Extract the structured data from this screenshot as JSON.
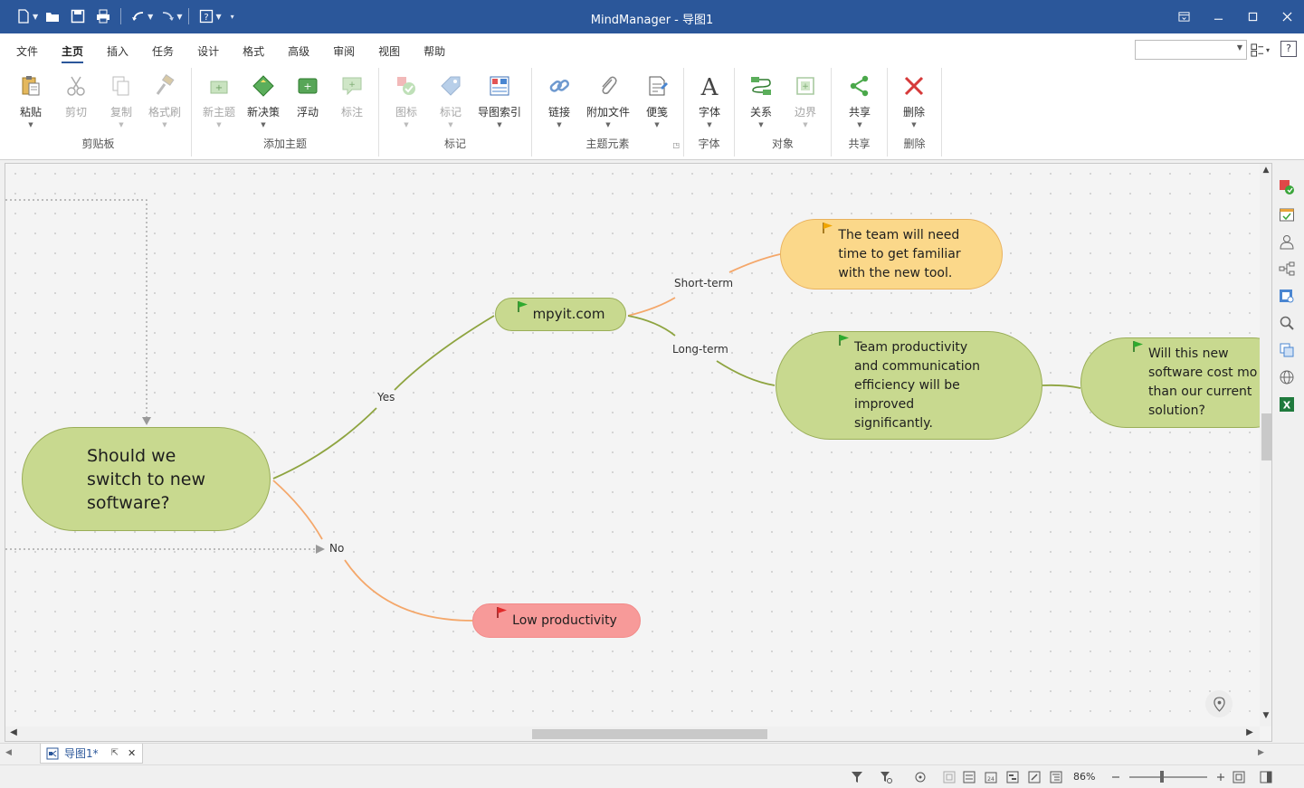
{
  "app": {
    "title": "MindManager - 导图1"
  },
  "quick_access": {
    "icons": [
      "new-icon",
      "open-icon",
      "save-icon",
      "print-icon",
      "undo-icon",
      "redo-icon",
      "help-icon",
      "customize-icon"
    ]
  },
  "menu": {
    "tabs": [
      {
        "label": "文件"
      },
      {
        "label": "主页"
      },
      {
        "label": "插入"
      },
      {
        "label": "任务"
      },
      {
        "label": "设计"
      },
      {
        "label": "格式"
      },
      {
        "label": "高级"
      },
      {
        "label": "审阅"
      },
      {
        "label": "视图"
      },
      {
        "label": "帮助"
      }
    ],
    "active_tab": "主页"
  },
  "ribbon": {
    "groups": [
      {
        "label": "剪贴板",
        "buttons": [
          {
            "label": "粘贴",
            "icon": "paste-icon",
            "enabled": true
          },
          {
            "label": "剪切",
            "icon": "cut-icon",
            "enabled": false
          },
          {
            "label": "复制",
            "icon": "copy-icon",
            "enabled": false
          },
          {
            "label": "格式刷",
            "icon": "format-painter-icon",
            "enabled": false
          }
        ]
      },
      {
        "label": "添加主题",
        "buttons": [
          {
            "label": "新主题",
            "icon": "new-topic-icon",
            "enabled": false
          },
          {
            "label": "新决策",
            "icon": "new-decision-icon",
            "enabled": true
          },
          {
            "label": "浮动",
            "icon": "floating-topic-icon",
            "enabled": true
          },
          {
            "label": "标注",
            "icon": "callout-icon",
            "enabled": false
          }
        ]
      },
      {
        "label": "标记",
        "buttons": [
          {
            "label": "图标",
            "icon": "icon-marker-icon",
            "enabled": false
          },
          {
            "label": "标记",
            "icon": "tag-icon",
            "enabled": false
          },
          {
            "label": "导图索引",
            "icon": "map-index-icon",
            "enabled": true
          }
        ]
      },
      {
        "label": "主题元素",
        "buttons": [
          {
            "label": "链接",
            "icon": "link-icon",
            "enabled": true
          },
          {
            "label": "附加文件",
            "icon": "attachment-icon",
            "enabled": true
          },
          {
            "label": "便笺",
            "icon": "notes-icon",
            "enabled": true
          }
        ]
      },
      {
        "label": "字体",
        "buttons": [
          {
            "label": "字体",
            "icon": "font-icon",
            "enabled": true
          }
        ]
      },
      {
        "label": "对象",
        "buttons": [
          {
            "label": "关系",
            "icon": "relationship-icon",
            "enabled": true
          },
          {
            "label": "边界",
            "icon": "boundary-icon",
            "enabled": false
          }
        ]
      },
      {
        "label": "共享",
        "buttons": [
          {
            "label": "共享",
            "icon": "share-icon",
            "enabled": true
          }
        ]
      },
      {
        "label": "删除",
        "buttons": [
          {
            "label": "删除",
            "icon": "delete-icon",
            "enabled": true
          }
        ]
      }
    ]
  },
  "map": {
    "central_topic": "Should we\nswitch to new\nsoftware?",
    "topics": {
      "yes_branch": "mpyit.com",
      "short_term": "The team will need\ntime to get familiar\nwith the new tool.",
      "long_term": "Team productivity\nand communication\nefficiency will be\nimproved\nsignificantly.",
      "followup": "Will this new\nsoftware cost mo\nthan our current\nsolution?",
      "no_branch": "Low productivity"
    },
    "link_labels": {
      "yes": "Yes",
      "no": "No",
      "short_term": "Short-term",
      "long_term": "Long-term"
    },
    "colors": {
      "green_topic": "#c8d98f",
      "green_border": "#9aae58",
      "yellow_topic": "#fbd88a",
      "yellow_border": "#e9b25e",
      "red_topic": "#f79a99",
      "green_line": "#8ea440",
      "orange_line": "#f4a76a",
      "title_bar": "#2b579a"
    }
  },
  "tabs": {
    "document": "导图1*"
  },
  "status": {
    "zoom": "86%"
  }
}
